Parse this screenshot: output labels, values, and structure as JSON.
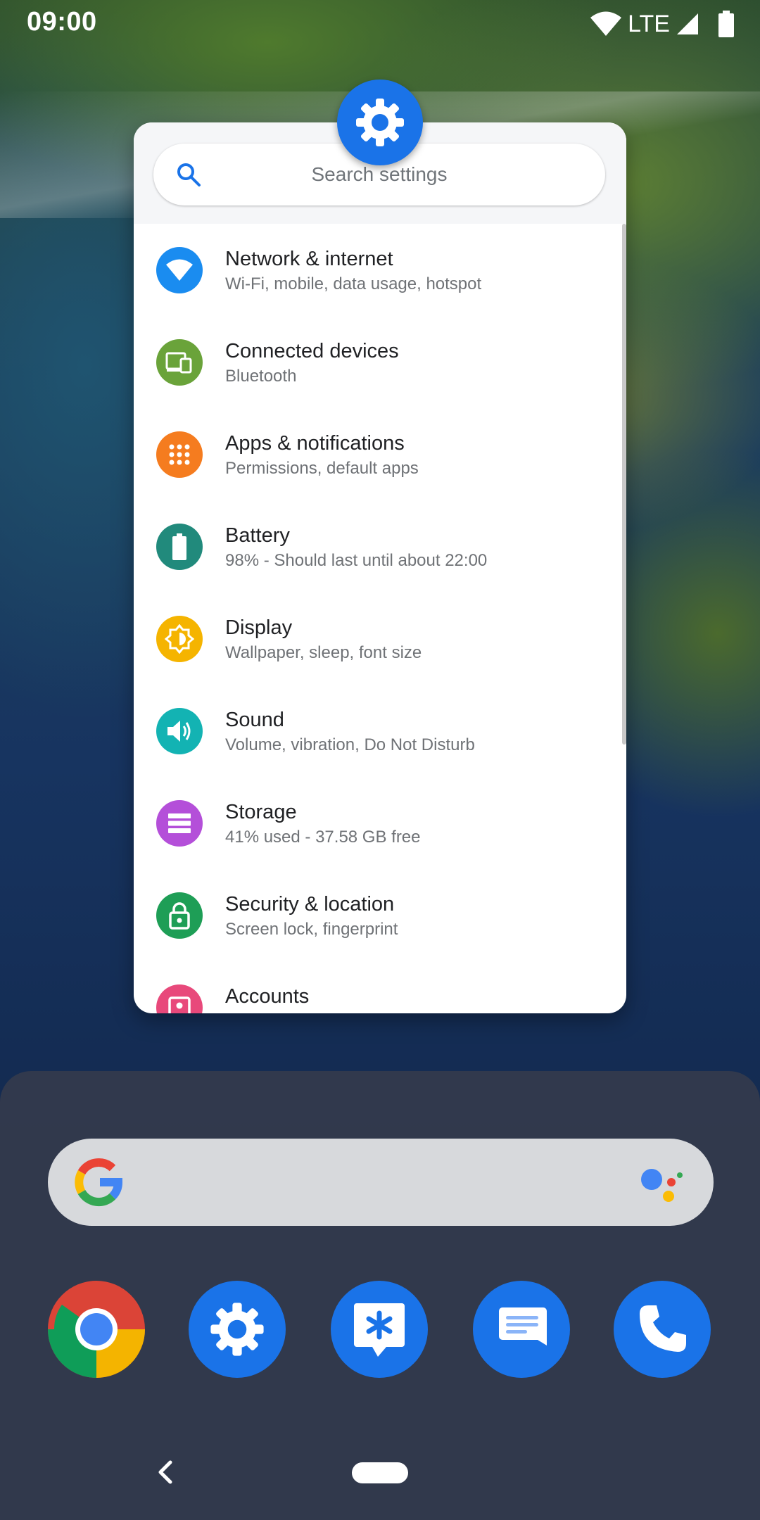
{
  "status_bar": {
    "time": "09:00",
    "network_type": "LTE",
    "icons": [
      "wifi-icon",
      "cell-signal-icon",
      "battery-icon"
    ]
  },
  "settings_popup": {
    "app_icon": "settings-gear-icon",
    "search_placeholder": "Search settings",
    "items": [
      {
        "title": "Network & internet",
        "subtitle": "Wi-Fi, mobile, data usage, hotspot",
        "icon": "wifi-icon",
        "color": "#1a8cf0"
      },
      {
        "title": "Connected devices",
        "subtitle": "Bluetooth",
        "icon": "devices-icon",
        "color": "#6aa33a"
      },
      {
        "title": "Apps & notifications",
        "subtitle": "Permissions, default apps",
        "icon": "apps-grid-icon",
        "color": "#f57c1f"
      },
      {
        "title": "Battery",
        "subtitle": "98% - Should last until about 22:00",
        "icon": "battery-icon",
        "color": "#218a7c"
      },
      {
        "title": "Display",
        "subtitle": "Wallpaper, sleep, font size",
        "icon": "brightness-icon",
        "color": "#f5b400"
      },
      {
        "title": "Sound",
        "subtitle": "Volume, vibration, Do Not Disturb",
        "icon": "speaker-icon",
        "color": "#13b3b3"
      },
      {
        "title": "Storage",
        "subtitle": "41% used - 37.58 GB free",
        "icon": "storage-icon",
        "color": "#b44fd9"
      },
      {
        "title": "Security & location",
        "subtitle": "Screen lock, fingerprint",
        "icon": "lock-icon",
        "color": "#1e9e56"
      },
      {
        "title": "Accounts",
        "subtitle": "",
        "icon": "account-icon",
        "color": "#e8497b"
      }
    ]
  },
  "dock": {
    "search_bar": {
      "logo": "google-g-icon",
      "assistant": "google-assistant-icon"
    },
    "apps": [
      {
        "name": "chrome-app-icon"
      },
      {
        "name": "settings-app-icon"
      },
      {
        "name": "support-app-icon"
      },
      {
        "name": "messages-app-icon"
      },
      {
        "name": "phone-app-icon"
      }
    ]
  },
  "nav_bar": {
    "back": "back-chevron-icon",
    "home": "home-pill"
  }
}
